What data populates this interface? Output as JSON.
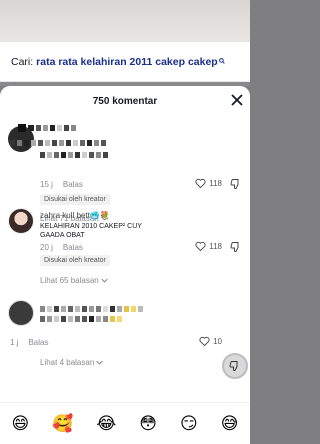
{
  "search": {
    "prefix": "Cari:",
    "query": "rata rata kelahiran 2011 cakep cakep",
    "icon": "search-icon"
  },
  "sheet": {
    "comment_count": "750 komentar",
    "close_icon": "close-icon"
  },
  "comments": [
    {
      "username": "",
      "text": "",
      "age": "15 j",
      "reply_label": "Balas",
      "badge": "Disukai oleh kreator",
      "likes": "118",
      "view_replies": "Lihat 71 balasan"
    },
    {
      "username": "zahra kull bett🥶💐",
      "text_line1": "KELAHIRAN 2010 CAKEP² CUY",
      "text_line2": "GAADA OBAT",
      "age": "20 j",
      "reply_label": "Balas",
      "badge": "Disukai oleh kreator",
      "likes": "118",
      "view_replies": "Lihat 65 balasan"
    },
    {
      "username": "",
      "text": "",
      "age": "1 j",
      "reply_label": "Balas",
      "likes": "10",
      "view_replies": "Lihat 4 balasan"
    }
  ],
  "emoji_bar": [
    "😄",
    "🥰",
    "😂",
    "😳",
    "😏",
    "😅"
  ],
  "colors": {
    "link_query": "#1a2e8c",
    "muted": "#8a8b91",
    "text": "#161823"
  }
}
